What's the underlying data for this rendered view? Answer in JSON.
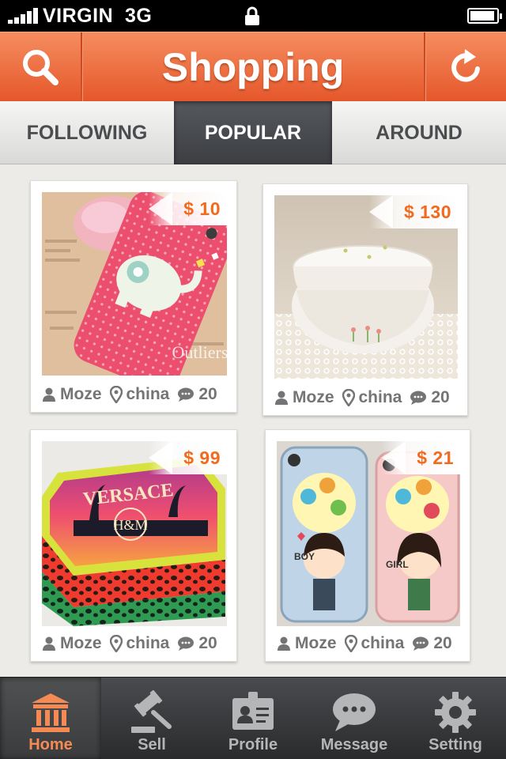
{
  "status_bar": {
    "carrier": "VIRGIN",
    "network": "3G",
    "battery_level": 0.95
  },
  "header": {
    "title": "Shopping",
    "left_icon": "search-icon",
    "right_icon": "refresh-icon"
  },
  "tabs": [
    {
      "label": "FOLLOWING",
      "active": false
    },
    {
      "label": "POPULAR",
      "active": true
    },
    {
      "label": "AROUND",
      "active": false
    }
  ],
  "products": [
    {
      "price": "$ 10",
      "user": "Moze",
      "location": "china",
      "comments": "20",
      "image": "pink-elephant-phone-case"
    },
    {
      "price": "$ 130",
      "user": "Moze",
      "location": "china",
      "comments": "20",
      "image": "white-ceramic-bowls"
    },
    {
      "price": "$ 99",
      "user": "Moze",
      "location": "china",
      "comments": "20",
      "image": "versace-hm-gift-box"
    },
    {
      "price": "$ 21",
      "user": "Moze",
      "location": "china",
      "comments": "20",
      "image": "cartoon-couple-phone-cases"
    }
  ],
  "tabbar": [
    {
      "label": "Home",
      "icon": "home-icon",
      "active": true
    },
    {
      "label": "Sell",
      "icon": "gavel-icon",
      "active": false
    },
    {
      "label": "Profile",
      "icon": "id-card-icon",
      "active": false
    },
    {
      "label": "Message",
      "icon": "chat-bubble-icon",
      "active": false
    },
    {
      "label": "Setting",
      "icon": "gear-icon",
      "active": false
    }
  ],
  "colors": {
    "accent": "#e8602f",
    "price": "#f26a1e",
    "tab_active_bg": "#46484c",
    "active_label": "#f58a55"
  }
}
